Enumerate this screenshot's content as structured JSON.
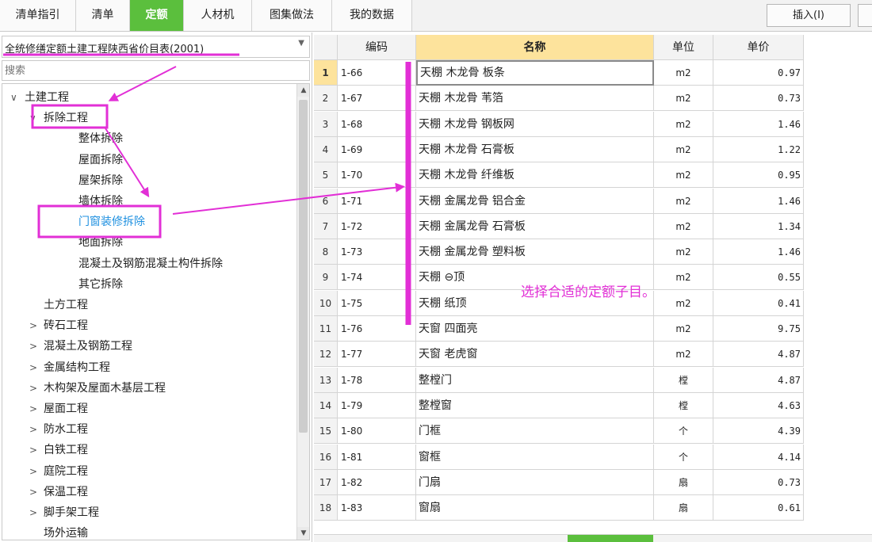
{
  "tabs": [
    {
      "label": "清单指引",
      "active": false
    },
    {
      "label": "清单",
      "active": false
    },
    {
      "label": "定额",
      "active": true
    },
    {
      "label": "人材机",
      "active": false
    },
    {
      "label": "图集做法",
      "active": false
    },
    {
      "label": "我的数据",
      "active": false
    }
  ],
  "toolbar": {
    "insert_label": "插入(I)"
  },
  "left": {
    "dataset": "全统修缮定额土建工程陕西省价目表(2001)",
    "search_placeholder": "搜索",
    "tree": [
      {
        "label": "土建工程",
        "level": 0,
        "arrow": "∨",
        "selected": false
      },
      {
        "label": "拆除工程",
        "level": 1,
        "arrow": "∨",
        "selected": false
      },
      {
        "label": "整体拆除",
        "level": 2,
        "arrow": "",
        "selected": false
      },
      {
        "label": "屋面拆除",
        "level": 2,
        "arrow": "",
        "selected": false
      },
      {
        "label": "屋架拆除",
        "level": 2,
        "arrow": "",
        "selected": false
      },
      {
        "label": "墙体拆除",
        "level": 2,
        "arrow": "",
        "selected": false
      },
      {
        "label": "门窗装修拆除",
        "level": 2,
        "arrow": "",
        "selected": true
      },
      {
        "label": "地面拆除",
        "level": 2,
        "arrow": "",
        "selected": false
      },
      {
        "label": "混凝土及钢筋混凝土构件拆除",
        "level": 2,
        "arrow": "",
        "selected": false
      },
      {
        "label": "其它拆除",
        "level": 2,
        "arrow": "",
        "selected": false
      },
      {
        "label": "土方工程",
        "level": 1,
        "arrow": "",
        "selected": false
      },
      {
        "label": "砖石工程",
        "level": 1,
        "arrow": ">",
        "selected": false
      },
      {
        "label": "混凝土及钢筋工程",
        "level": 1,
        "arrow": ">",
        "selected": false
      },
      {
        "label": "金属结构工程",
        "level": 1,
        "arrow": ">",
        "selected": false
      },
      {
        "label": "木构架及屋面木基层工程",
        "level": 1,
        "arrow": ">",
        "selected": false
      },
      {
        "label": "屋面工程",
        "level": 1,
        "arrow": ">",
        "selected": false
      },
      {
        "label": "防水工程",
        "level": 1,
        "arrow": ">",
        "selected": false
      },
      {
        "label": "白铁工程",
        "level": 1,
        "arrow": ">",
        "selected": false
      },
      {
        "label": "庭院工程",
        "level": 1,
        "arrow": ">",
        "selected": false
      },
      {
        "label": "保温工程",
        "level": 1,
        "arrow": ">",
        "selected": false
      },
      {
        "label": "脚手架工程",
        "level": 1,
        "arrow": ">",
        "selected": false
      },
      {
        "label": "场外运输",
        "level": 1,
        "arrow": "",
        "selected": false
      }
    ]
  },
  "grid": {
    "headers": {
      "code": "编码",
      "name": "名称",
      "unit": "单位",
      "price": "单价"
    },
    "rows": [
      {
        "idx": "1",
        "code": "1-66",
        "name": "天棚 木龙骨 板条",
        "unit": "m2",
        "price": "0.97"
      },
      {
        "idx": "2",
        "code": "1-67",
        "name": "天棚 木龙骨 苇箔",
        "unit": "m2",
        "price": "0.73"
      },
      {
        "idx": "3",
        "code": "1-68",
        "name": "天棚 木龙骨 钢板网",
        "unit": "m2",
        "price": "1.46"
      },
      {
        "idx": "4",
        "code": "1-69",
        "name": "天棚 木龙骨 石膏板",
        "unit": "m2",
        "price": "1.22"
      },
      {
        "idx": "5",
        "code": "1-70",
        "name": "天棚 木龙骨 纤维板",
        "unit": "m2",
        "price": "0.95"
      },
      {
        "idx": "6",
        "code": "1-71",
        "name": "天棚 金属龙骨 铝合金",
        "unit": "m2",
        "price": "1.46"
      },
      {
        "idx": "7",
        "code": "1-72",
        "name": "天棚 金属龙骨 石膏板",
        "unit": "m2",
        "price": "1.34"
      },
      {
        "idx": "8",
        "code": "1-73",
        "name": "天棚 金属龙骨 塑料板",
        "unit": "m2",
        "price": "1.46"
      },
      {
        "idx": "9",
        "code": "1-74",
        "name": "天棚 ⊖顶",
        "unit": "m2",
        "price": "0.55"
      },
      {
        "idx": "10",
        "code": "1-75",
        "name": "天棚 纸顶",
        "unit": "m2",
        "price": "0.41"
      },
      {
        "idx": "11",
        "code": "1-76",
        "name": "天窗 四面亮",
        "unit": "m2",
        "price": "9.75"
      },
      {
        "idx": "12",
        "code": "1-77",
        "name": "天窗 老虎窗",
        "unit": "m2",
        "price": "4.87"
      },
      {
        "idx": "13",
        "code": "1-78",
        "name": "整樘门",
        "unit": "樘",
        "price": "4.87"
      },
      {
        "idx": "14",
        "code": "1-79",
        "name": "整樘窗",
        "unit": "樘",
        "price": "4.63"
      },
      {
        "idx": "15",
        "code": "1-80",
        "name": "门框",
        "unit": "个",
        "price": "4.39"
      },
      {
        "idx": "16",
        "code": "1-81",
        "name": "窗框",
        "unit": "个",
        "price": "4.14"
      },
      {
        "idx": "17",
        "code": "1-82",
        "name": "门扇",
        "unit": "扇",
        "price": "0.73"
      },
      {
        "idx": "18",
        "code": "1-83",
        "name": "窗扇",
        "unit": "扇",
        "price": "0.61"
      }
    ]
  },
  "annotation": {
    "text": "选择合适的定额子目。",
    "color": "#e22fd6"
  },
  "colors": {
    "accent": "#5bbf3d",
    "header_highlight": "#fde39c",
    "selected_tree": "#1e90e0"
  }
}
